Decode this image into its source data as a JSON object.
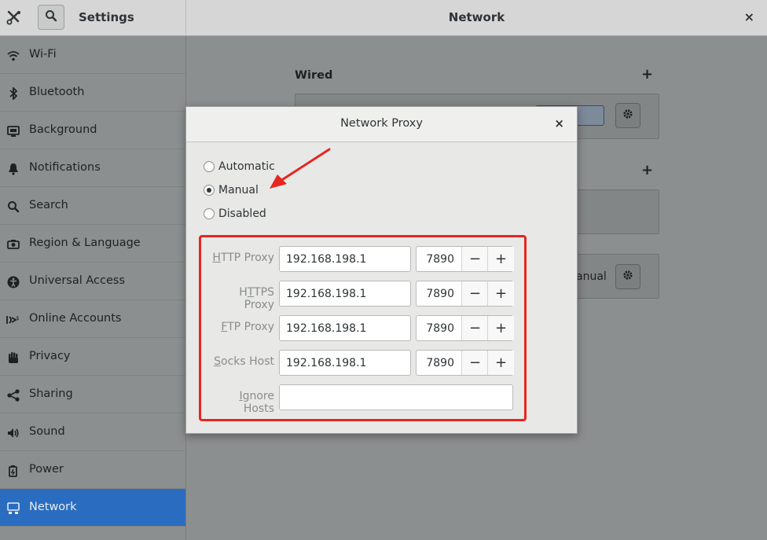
{
  "window": {
    "app_title": "Settings",
    "panel_title": "Network",
    "close_glyph": "×"
  },
  "sidebar": {
    "items": [
      {
        "label": "Wi-Fi",
        "icon": "wifi-icon"
      },
      {
        "label": "Bluetooth",
        "icon": "bluetooth-icon"
      },
      {
        "label": "Background",
        "icon": "background-icon"
      },
      {
        "label": "Notifications",
        "icon": "bell-icon"
      },
      {
        "label": "Search",
        "icon": "search-icon"
      },
      {
        "label": "Region & Language",
        "icon": "camera-icon"
      },
      {
        "label": "Universal Access",
        "icon": "accessibility-icon"
      },
      {
        "label": "Online Accounts",
        "icon": "online-accounts-icon"
      },
      {
        "label": "Privacy",
        "icon": "hand-icon"
      },
      {
        "label": "Sharing",
        "icon": "share-icon"
      },
      {
        "label": "Sound",
        "icon": "speaker-icon"
      },
      {
        "label": "Power",
        "icon": "power-icon"
      },
      {
        "label": "Network",
        "icon": "network-icon",
        "active": true
      }
    ]
  },
  "main": {
    "wired_title": "Wired",
    "add_glyph": "+",
    "manual_peek": "anual"
  },
  "dialog": {
    "title": "Network Proxy",
    "close_glyph": "×",
    "modes": [
      {
        "label": "Automatic",
        "checked": false
      },
      {
        "label": "Manual",
        "checked": true
      },
      {
        "label": "Disabled",
        "checked": false
      }
    ],
    "proxies": [
      {
        "label_pre": "",
        "label_ul": "H",
        "label_post": "TTP Proxy",
        "host": "192.168.198.1",
        "port": "7890"
      },
      {
        "label_pre": "H",
        "label_ul": "T",
        "label_post": "TPS Proxy",
        "host": "192.168.198.1",
        "port": "7890"
      },
      {
        "label_pre": "",
        "label_ul": "F",
        "label_post": "TP Proxy",
        "host": "192.168.198.1",
        "port": "7890"
      },
      {
        "label_pre": "",
        "label_ul": "S",
        "label_post": "ocks Host",
        "host": "192.168.198.1",
        "port": "7890"
      }
    ],
    "ignore": {
      "label_pre": "",
      "label_ul": "I",
      "label_post": "gnore Hosts",
      "value": ""
    },
    "minus_glyph": "−",
    "plus_glyph": "+"
  },
  "colors": {
    "accent_active": "#2a6dc0",
    "annotation_red": "#e8251f"
  }
}
